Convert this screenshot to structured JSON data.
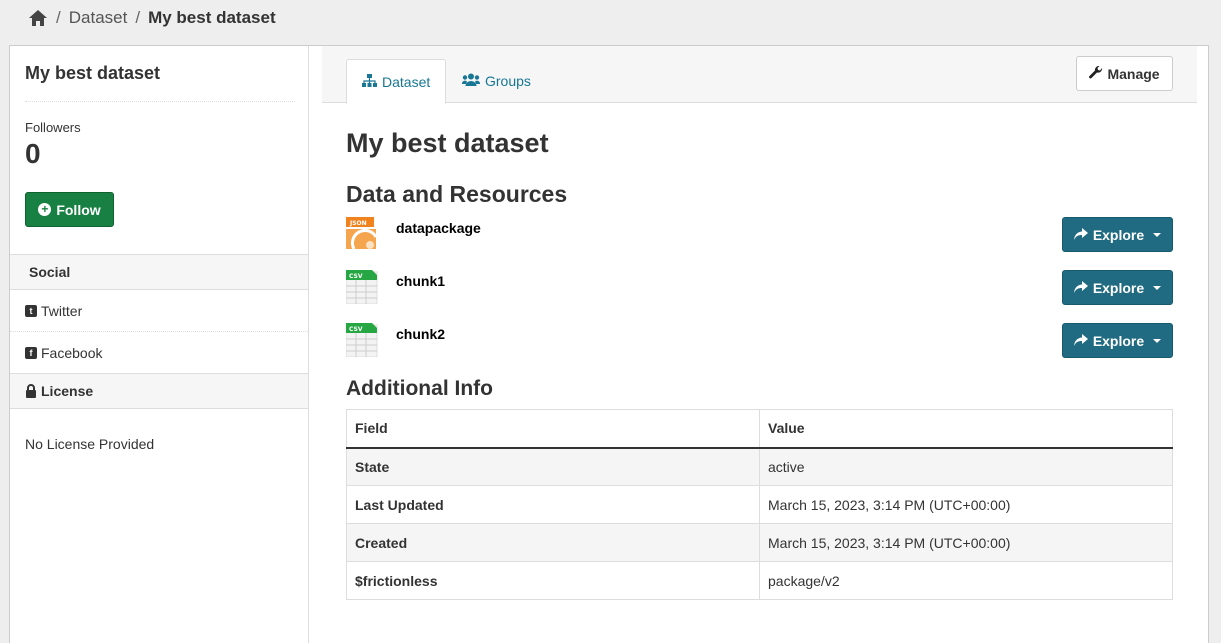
{
  "breadcrumb": {
    "items": [
      "Dataset",
      "My best dataset"
    ]
  },
  "sidebar": {
    "title": "My best dataset",
    "followers_label": "Followers",
    "followers_count": "0",
    "follow_label": "Follow",
    "social_heading": "Social",
    "twitter_label": "Twitter",
    "facebook_label": "Facebook",
    "license_heading": "License",
    "license_text": "No License Provided"
  },
  "tabs": [
    {
      "label": "Dataset",
      "icon": "sitemap-icon",
      "active": true
    },
    {
      "label": "Groups",
      "icon": "users-icon",
      "active": false
    }
  ],
  "manage_label": "Manage",
  "main": {
    "title": "My best dataset",
    "resources_heading": "Data and Resources",
    "resources": [
      {
        "name": "datapackage",
        "format": "JSON",
        "format_color": "#f0831e"
      },
      {
        "name": "chunk1",
        "format": "CSV",
        "format_color": "#27a744"
      },
      {
        "name": "chunk2",
        "format": "CSV",
        "format_color": "#27a744"
      }
    ],
    "explore_label": "Explore",
    "info_heading": "Additional Info",
    "table": {
      "headers": [
        "Field",
        "Value"
      ],
      "rows": [
        [
          "State",
          "active"
        ],
        [
          "Last Updated",
          "March 15, 2023, 3:14 PM (UTC+00:00)"
        ],
        [
          "Created",
          "March 15, 2023, 3:14 PM (UTC+00:00)"
        ],
        [
          "$frictionless",
          "package/v2"
        ]
      ]
    }
  },
  "colors": {
    "link": "#187794",
    "follow_button": "#188042",
    "explore_button": "#206b82"
  }
}
